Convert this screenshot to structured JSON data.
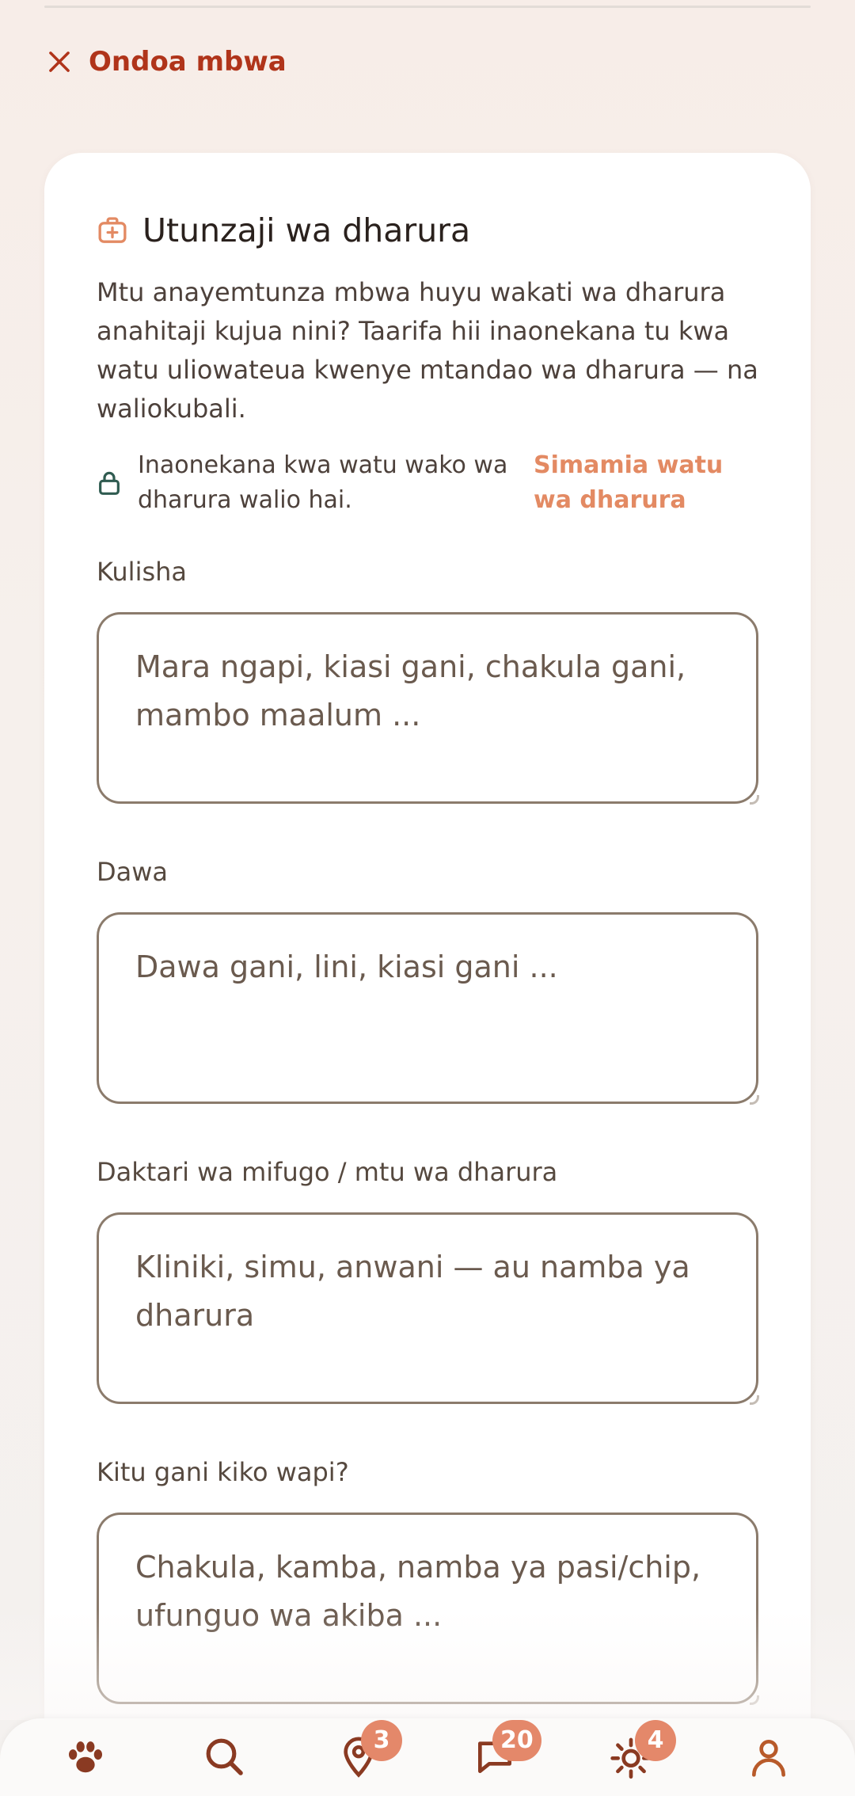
{
  "header": {
    "remove_label": "Ondoa mbwa"
  },
  "card": {
    "title": "Utunzaji wa dharura",
    "description": "Mtu anayemtunza mbwa huyu wakati wa dharura anahitaji kujua nini? Taarifa hii inaonekana tu kwa watu uliowateua kwenye mtandao wa dharura — na waliokubali.",
    "visibility_note": "Inaonekana kwa watu wako wa dharura walio hai.",
    "manage_link": "Simamia watu wa dharura"
  },
  "fields": [
    {
      "label": "Kulisha",
      "placeholder": "Mara ngapi, kiasi gani, chakula gani, mambo maalum ..."
    },
    {
      "label": "Dawa",
      "placeholder": "Dawa gani, lini, kiasi gani ..."
    },
    {
      "label": "Daktari wa mifugo / mtu wa dharura",
      "placeholder": "Kliniki, simu, anwani — au namba ya dharura"
    },
    {
      "label": "Kitu gani kiko wapi?",
      "placeholder": "Chakula, kamba, namba ya pasi/chip, ufunguo wa akiba ..."
    }
  ],
  "nav": {
    "items": [
      {
        "icon": "paw-icon"
      },
      {
        "icon": "search-icon"
      },
      {
        "icon": "location-pin-icon",
        "badge": "3"
      },
      {
        "icon": "chat-icon",
        "badge": "20"
      },
      {
        "icon": "sun-icon",
        "badge": "4"
      },
      {
        "icon": "profile-icon"
      }
    ]
  },
  "colors": {
    "accent": "#b0341a",
    "link": "#e38a63",
    "badge": "#e4886a",
    "profile_active": "#b85a2a"
  }
}
